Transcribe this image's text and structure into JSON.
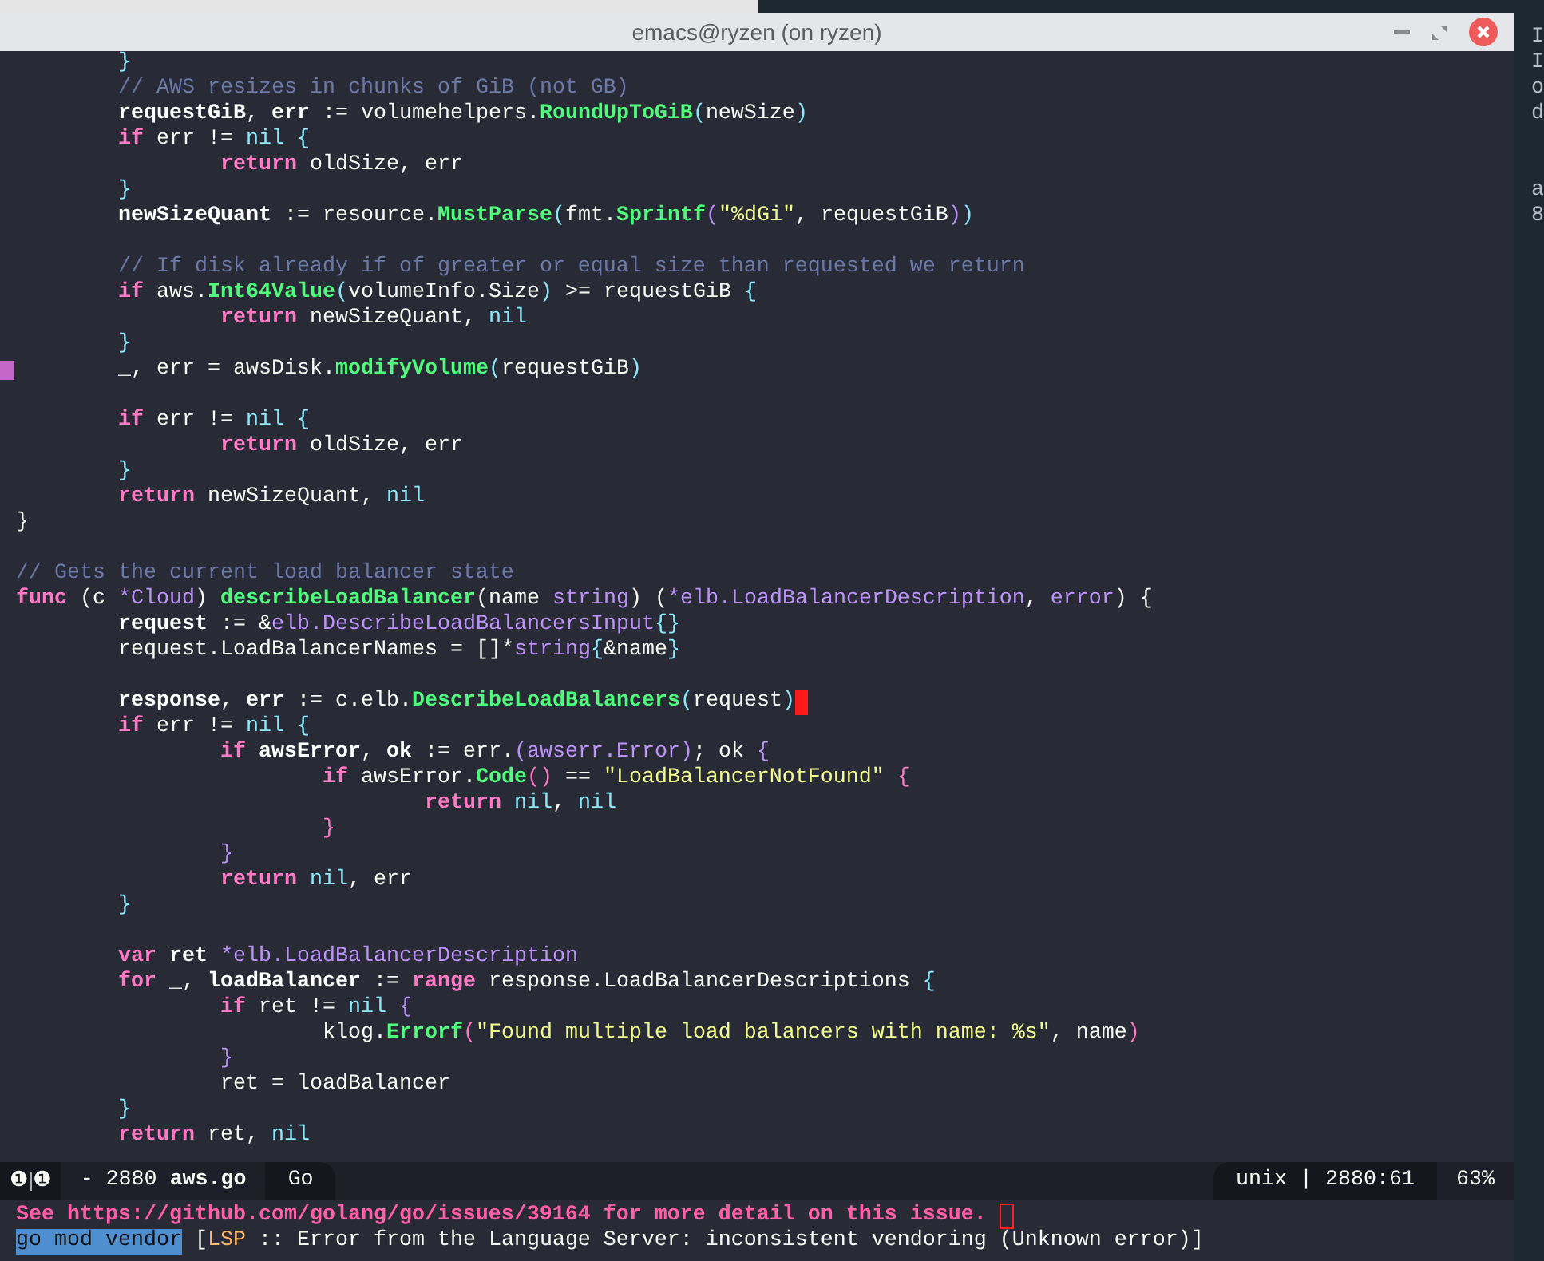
{
  "window": {
    "title": "emacs@ryzen (on ryzen)"
  },
  "background_terminal": {
    "line_groups": [
      [
        "I",
        "I",
        "o",
        "d"
      ],
      [
        "a",
        "8"
      ]
    ]
  },
  "editor": {
    "lines": [
      {
        "kind": "code",
        "cursor": false,
        "fringe_marker": false,
        "segments": [
          {
            "kind": "b2",
            "text": "\t}"
          }
        ]
      },
      {
        "kind": "code",
        "cursor": false,
        "fringe_marker": false,
        "segments": [
          {
            "kind": "c",
            "text": "\t// AWS resizes in chunks of GiB (not GB)"
          }
        ]
      },
      {
        "kind": "code",
        "cursor": false,
        "fringe_marker": false,
        "segments": [
          {
            "kind": "v",
            "text": "\trequestGiB"
          },
          {
            "kind": "p",
            "text": ", "
          },
          {
            "kind": "v",
            "text": "err"
          },
          {
            "kind": "p",
            "text": " := volumehelpers."
          },
          {
            "kind": "f",
            "text": "RoundUpToGiB"
          },
          {
            "kind": "b2",
            "text": "("
          },
          {
            "kind": "p",
            "text": "newSize"
          },
          {
            "kind": "b2",
            "text": ")"
          }
        ]
      },
      {
        "kind": "code",
        "cursor": false,
        "fringe_marker": false,
        "segments": [
          {
            "kind": "k",
            "text": "\tif"
          },
          {
            "kind": "p",
            "text": " err != "
          },
          {
            "kind": "n",
            "text": "nil"
          },
          {
            "kind": "b2",
            "text": " {"
          }
        ]
      },
      {
        "kind": "code",
        "cursor": false,
        "fringe_marker": false,
        "segments": [
          {
            "kind": "k",
            "text": "\t\treturn"
          },
          {
            "kind": "p",
            "text": " oldSize, err"
          }
        ]
      },
      {
        "kind": "code",
        "cursor": false,
        "fringe_marker": false,
        "segments": [
          {
            "kind": "b2",
            "text": "\t}"
          }
        ]
      },
      {
        "kind": "code",
        "cursor": false,
        "fringe_marker": false,
        "segments": [
          {
            "kind": "v",
            "text": "\tnewSizeQuant"
          },
          {
            "kind": "p",
            "text": " := resource."
          },
          {
            "kind": "f",
            "text": "MustParse"
          },
          {
            "kind": "b2",
            "text": "("
          },
          {
            "kind": "p",
            "text": "fmt."
          },
          {
            "kind": "f",
            "text": "Sprintf"
          },
          {
            "kind": "b3",
            "text": "("
          },
          {
            "kind": "s",
            "text": "\"%dGi\""
          },
          {
            "kind": "p",
            "text": ", requestGiB"
          },
          {
            "kind": "b3",
            "text": ")"
          },
          {
            "kind": "b2",
            "text": ")"
          }
        ]
      },
      {
        "kind": "blank"
      },
      {
        "kind": "code",
        "cursor": false,
        "fringe_marker": false,
        "segments": [
          {
            "kind": "c",
            "text": "\t// If disk already if of greater or equal size than requested we return"
          }
        ]
      },
      {
        "kind": "code",
        "cursor": false,
        "fringe_marker": false,
        "segments": [
          {
            "kind": "k",
            "text": "\tif"
          },
          {
            "kind": "p",
            "text": " aws."
          },
          {
            "kind": "f",
            "text": "Int64Value"
          },
          {
            "kind": "b2",
            "text": "("
          },
          {
            "kind": "p",
            "text": "volumeInfo.Size"
          },
          {
            "kind": "b2",
            "text": ")"
          },
          {
            "kind": "p",
            "text": " >= requestGiB"
          },
          {
            "kind": "b2",
            "text": " {"
          }
        ]
      },
      {
        "kind": "code",
        "cursor": false,
        "fringe_marker": false,
        "segments": [
          {
            "kind": "k",
            "text": "\t\treturn"
          },
          {
            "kind": "p",
            "text": " newSizeQuant, "
          },
          {
            "kind": "n",
            "text": "nil"
          }
        ]
      },
      {
        "kind": "code",
        "cursor": false,
        "fringe_marker": false,
        "segments": [
          {
            "kind": "b2",
            "text": "\t}"
          }
        ]
      },
      {
        "kind": "code",
        "cursor": false,
        "fringe_marker": true,
        "segments": [
          {
            "kind": "p",
            "text": "\t_, err = awsDisk."
          },
          {
            "kind": "f",
            "text": "modifyVolume"
          },
          {
            "kind": "b2",
            "text": "("
          },
          {
            "kind": "p",
            "text": "requestGiB"
          },
          {
            "kind": "b2",
            "text": ")"
          }
        ]
      },
      {
        "kind": "blank"
      },
      {
        "kind": "code",
        "cursor": false,
        "fringe_marker": false,
        "segments": [
          {
            "kind": "k",
            "text": "\tif"
          },
          {
            "kind": "p",
            "text": " err != "
          },
          {
            "kind": "n",
            "text": "nil"
          },
          {
            "kind": "b2",
            "text": " {"
          }
        ]
      },
      {
        "kind": "code",
        "cursor": false,
        "fringe_marker": false,
        "segments": [
          {
            "kind": "k",
            "text": "\t\treturn"
          },
          {
            "kind": "p",
            "text": " oldSize, err"
          }
        ]
      },
      {
        "kind": "code",
        "cursor": false,
        "fringe_marker": false,
        "segments": [
          {
            "kind": "b2",
            "text": "\t}"
          }
        ]
      },
      {
        "kind": "code",
        "cursor": false,
        "fringe_marker": false,
        "segments": [
          {
            "kind": "k",
            "text": "\treturn"
          },
          {
            "kind": "p",
            "text": " newSizeQuant, "
          },
          {
            "kind": "n",
            "text": "nil"
          }
        ]
      },
      {
        "kind": "code",
        "cursor": false,
        "fringe_marker": false,
        "segments": [
          {
            "kind": "b1",
            "text": "}"
          }
        ]
      },
      {
        "kind": "blank"
      },
      {
        "kind": "code",
        "cursor": false,
        "fringe_marker": false,
        "segments": [
          {
            "kind": "c",
            "text": "// Gets the current load balancer state"
          }
        ]
      },
      {
        "kind": "code",
        "cursor": false,
        "fringe_marker": false,
        "segments": [
          {
            "kind": "k",
            "text": "func"
          },
          {
            "kind": "b1",
            "text": " ("
          },
          {
            "kind": "p",
            "text": "c "
          },
          {
            "kind": "t",
            "text": "*Cloud"
          },
          {
            "kind": "b1",
            "text": ")"
          },
          {
            "kind": "f",
            "text": " describeLoadBalancer"
          },
          {
            "kind": "b1",
            "text": "("
          },
          {
            "kind": "p",
            "text": "name "
          },
          {
            "kind": "t",
            "text": "string"
          },
          {
            "kind": "b1",
            "text": ") ("
          },
          {
            "kind": "t",
            "text": "*elb.LoadBalancerDescription"
          },
          {
            "kind": "p",
            "text": ", "
          },
          {
            "kind": "t",
            "text": "error"
          },
          {
            "kind": "b1",
            "text": ") {"
          }
        ]
      },
      {
        "kind": "code",
        "cursor": false,
        "fringe_marker": false,
        "segments": [
          {
            "kind": "v",
            "text": "\trequest"
          },
          {
            "kind": "p",
            "text": " := &"
          },
          {
            "kind": "t",
            "text": "elb.DescribeLoadBalancersInput"
          },
          {
            "kind": "b2",
            "text": "{}"
          }
        ]
      },
      {
        "kind": "code",
        "cursor": false,
        "fringe_marker": false,
        "segments": [
          {
            "kind": "p",
            "text": "\trequest.LoadBalancerNames = []*"
          },
          {
            "kind": "t",
            "text": "string"
          },
          {
            "kind": "b2",
            "text": "{"
          },
          {
            "kind": "p",
            "text": "&name"
          },
          {
            "kind": "b2",
            "text": "}"
          }
        ]
      },
      {
        "kind": "blank"
      },
      {
        "kind": "code",
        "cursor": true,
        "fringe_marker": false,
        "segments": [
          {
            "kind": "v",
            "text": "\tresponse"
          },
          {
            "kind": "p",
            "text": ", "
          },
          {
            "kind": "v",
            "text": "err"
          },
          {
            "kind": "p",
            "text": " := c.elb."
          },
          {
            "kind": "f",
            "text": "DescribeLoadBalancers"
          },
          {
            "kind": "b2",
            "text": "("
          },
          {
            "kind": "p",
            "text": "request"
          },
          {
            "kind": "b2",
            "text": ")"
          }
        ]
      },
      {
        "kind": "code",
        "cursor": false,
        "fringe_marker": false,
        "segments": [
          {
            "kind": "k",
            "text": "\tif"
          },
          {
            "kind": "p",
            "text": " err != "
          },
          {
            "kind": "n",
            "text": "nil"
          },
          {
            "kind": "b2",
            "text": " {"
          }
        ]
      },
      {
        "kind": "code",
        "cursor": false,
        "fringe_marker": false,
        "segments": [
          {
            "kind": "k",
            "text": "\t\tif"
          },
          {
            "kind": "v",
            "text": " awsError"
          },
          {
            "kind": "p",
            "text": ", "
          },
          {
            "kind": "v",
            "text": "ok"
          },
          {
            "kind": "p",
            "text": " := err."
          },
          {
            "kind": "b3",
            "text": "("
          },
          {
            "kind": "t",
            "text": "awserr.Error"
          },
          {
            "kind": "b3",
            "text": ")"
          },
          {
            "kind": "p",
            "text": "; ok"
          },
          {
            "kind": "b3",
            "text": " {"
          }
        ]
      },
      {
        "kind": "code",
        "cursor": false,
        "fringe_marker": false,
        "segments": [
          {
            "kind": "k",
            "text": "\t\t\tif"
          },
          {
            "kind": "p",
            "text": " awsError."
          },
          {
            "kind": "f",
            "text": "Code"
          },
          {
            "kind": "b4",
            "text": "()"
          },
          {
            "kind": "p",
            "text": " == "
          },
          {
            "kind": "s",
            "text": "\"LoadBalancerNotFound\""
          },
          {
            "kind": "b4",
            "text": " {"
          }
        ]
      },
      {
        "kind": "code",
        "cursor": false,
        "fringe_marker": false,
        "segments": [
          {
            "kind": "k",
            "text": "\t\t\t\treturn"
          },
          {
            "kind": "n",
            "text": " nil"
          },
          {
            "kind": "p",
            "text": ", "
          },
          {
            "kind": "n",
            "text": "nil"
          }
        ]
      },
      {
        "kind": "code",
        "cursor": false,
        "fringe_marker": false,
        "segments": [
          {
            "kind": "b4",
            "text": "\t\t\t}"
          }
        ]
      },
      {
        "kind": "code",
        "cursor": false,
        "fringe_marker": false,
        "segments": [
          {
            "kind": "b3",
            "text": "\t\t}"
          }
        ]
      },
      {
        "kind": "code",
        "cursor": false,
        "fringe_marker": false,
        "segments": [
          {
            "kind": "k",
            "text": "\t\treturn"
          },
          {
            "kind": "n",
            "text": " nil"
          },
          {
            "kind": "p",
            "text": ", err"
          }
        ]
      },
      {
        "kind": "code",
        "cursor": false,
        "fringe_marker": false,
        "segments": [
          {
            "kind": "b2",
            "text": "\t}"
          }
        ]
      },
      {
        "kind": "blank"
      },
      {
        "kind": "code",
        "cursor": false,
        "fringe_marker": false,
        "segments": [
          {
            "kind": "k",
            "text": "\tvar"
          },
          {
            "kind": "v",
            "text": " ret"
          },
          {
            "kind": "t",
            "text": " *elb.LoadBalancerDescription"
          }
        ]
      },
      {
        "kind": "code",
        "cursor": false,
        "fringe_marker": false,
        "segments": [
          {
            "kind": "k",
            "text": "\tfor"
          },
          {
            "kind": "p",
            "text": " _, "
          },
          {
            "kind": "v",
            "text": "loadBalancer"
          },
          {
            "kind": "p",
            "text": " := "
          },
          {
            "kind": "k",
            "text": "range"
          },
          {
            "kind": "p",
            "text": " response.LoadBalancerDescriptions"
          },
          {
            "kind": "b2",
            "text": " {"
          }
        ]
      },
      {
        "kind": "code",
        "cursor": false,
        "fringe_marker": false,
        "segments": [
          {
            "kind": "k",
            "text": "\t\tif"
          },
          {
            "kind": "p",
            "text": " ret != "
          },
          {
            "kind": "n",
            "text": "nil"
          },
          {
            "kind": "b3",
            "text": " {"
          }
        ]
      },
      {
        "kind": "code",
        "cursor": false,
        "fringe_marker": false,
        "segments": [
          {
            "kind": "p",
            "text": "\t\t\tklog."
          },
          {
            "kind": "f",
            "text": "Errorf"
          },
          {
            "kind": "b4",
            "text": "("
          },
          {
            "kind": "s",
            "text": "\"Found multiple load balancers with name: %s\""
          },
          {
            "kind": "p",
            "text": ", name"
          },
          {
            "kind": "b4",
            "text": ")"
          }
        ]
      },
      {
        "kind": "code",
        "cursor": false,
        "fringe_marker": false,
        "segments": [
          {
            "kind": "b3",
            "text": "\t\t}"
          }
        ]
      },
      {
        "kind": "code",
        "cursor": false,
        "fringe_marker": false,
        "segments": [
          {
            "kind": "p",
            "text": "\t\tret = loadBalancer"
          }
        ]
      },
      {
        "kind": "code",
        "cursor": false,
        "fringe_marker": false,
        "segments": [
          {
            "kind": "b2",
            "text": "\t}"
          }
        ]
      },
      {
        "kind": "code",
        "cursor": false,
        "fringe_marker": false,
        "segments": [
          {
            "kind": "k",
            "text": "\treturn"
          },
          {
            "kind": "p",
            "text": " ret, "
          },
          {
            "kind": "n",
            "text": "nil"
          }
        ]
      }
    ]
  },
  "mode_line": {
    "window_numbers": [
      "❶",
      "❶"
    ],
    "buffer": "- 2880 **aws.go**",
    "mode": "Go",
    "position_info": "unix | 2880:61",
    "percent": "63%"
  },
  "echo_area": {
    "message": "See https://github.com/golang/go/issues/39164 for more detail on this issue.",
    "selection": "go mod vendor",
    "segments": [
      {
        "kind": "p",
        "text": " ["
      },
      {
        "kind": "tag",
        "text": "LSP"
      },
      {
        "kind": "p",
        "text": " :: Error from the Language Server: inconsistent vendoring (Unknown error)]"
      }
    ]
  }
}
